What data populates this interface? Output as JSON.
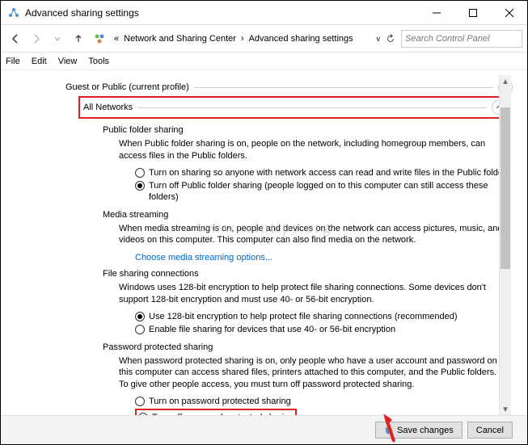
{
  "window": {
    "title": "Advanced sharing settings"
  },
  "nav": {
    "crumb1": "Network and Sharing Center",
    "crumb2": "Advanced sharing settings",
    "search_placeholder": "Search Control Panel"
  },
  "menu": {
    "file": "File",
    "edit": "Edit",
    "view": "View",
    "tools": "Tools"
  },
  "sections": {
    "guest": "Guest or Public (current profile)",
    "all": "All Networks",
    "pfs": {
      "title": "Public folder sharing",
      "desc": "When Public folder sharing is on, people on the network, including homegroup members, can access files in the Public folders.",
      "opt_on": "Turn on sharing so anyone with network access can read and write files in the Public folders",
      "opt_off": "Turn off Public folder sharing (people logged on to this computer can still access these folders)"
    },
    "ms": {
      "title": "Media streaming",
      "desc": "When media streaming is on, people and devices on the network can access pictures, music, and videos on this computer. This computer can also find media on the network.",
      "link": "Choose media streaming options..."
    },
    "fsc": {
      "title": "File sharing connections",
      "desc": "Windows uses 128-bit encryption to help protect file sharing connections. Some devices don't support 128-bit encryption and must use 40- or 56-bit encryption.",
      "opt128": "Use 128-bit encryption to help protect file sharing connections (recommended)",
      "opt40": "Enable file sharing for devices that use 40- or 56-bit encryption"
    },
    "pps": {
      "title": "Password protected sharing",
      "desc": "When password protected sharing is on, only people who have a user account and password on this computer can access shared files, printers attached to this computer, and the Public folders. To give other people access, you must turn off password protected sharing.",
      "opt_on": "Turn on password protected sharing",
      "opt_off": "Turn off password protected sharing"
    }
  },
  "footer": {
    "save": "Save changes",
    "cancel": "Cancel"
  },
  "watermark": "www.wintips.org"
}
